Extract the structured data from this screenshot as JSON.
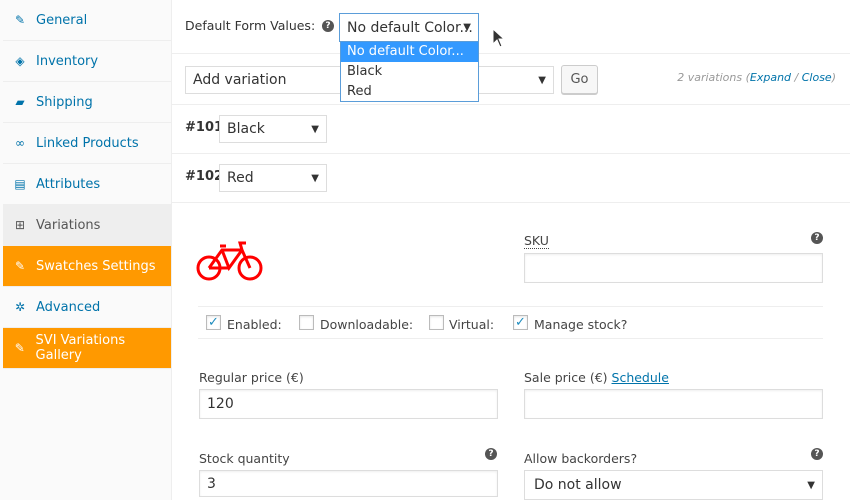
{
  "sidebar": {
    "items": [
      {
        "label": "General",
        "icon": "wrench-icon",
        "state": "normal"
      },
      {
        "label": "Inventory",
        "icon": "tag-icon",
        "state": "normal"
      },
      {
        "label": "Shipping",
        "icon": "truck-icon",
        "state": "normal"
      },
      {
        "label": "Linked Products",
        "icon": "link-icon",
        "state": "normal"
      },
      {
        "label": "Attributes",
        "icon": "list-icon",
        "state": "normal"
      },
      {
        "label": "Variations",
        "icon": "grid-icon",
        "state": "active"
      },
      {
        "label": "Swatches Settings",
        "icon": "wrench-icon",
        "state": "orange"
      },
      {
        "label": "Advanced",
        "icon": "gear-icon",
        "state": "normal"
      },
      {
        "label": "SVI Variations Gallery",
        "icon": "wrench-icon",
        "state": "orange"
      }
    ]
  },
  "defaults": {
    "label": "Default Form Values:",
    "selected": "No default Color...",
    "options": [
      "No default Color...",
      "Black",
      "Red"
    ]
  },
  "add": {
    "selected": "Add variation",
    "go": "Go",
    "count": "2 variations (",
    "expand": "Expand",
    "sep": " / ",
    "close": "Close",
    "end": ")"
  },
  "variations": [
    {
      "id": "#101",
      "value": "Black"
    },
    {
      "id": "#102",
      "value": "Red"
    }
  ],
  "panel": {
    "sku_label": "SKU",
    "sku_value": "",
    "checks": [
      {
        "label": "Enabled:",
        "checked": true
      },
      {
        "label": "Downloadable:",
        "checked": false
      },
      {
        "label": "Virtual:",
        "checked": false
      },
      {
        "label": "Manage stock?",
        "checked": true
      }
    ],
    "regular_label": "Regular price (€)",
    "regular_value": "120",
    "sale_label": "Sale price (€)",
    "schedule": "Schedule",
    "sale_value": "",
    "stock_label": "Stock quantity",
    "stock_value": "3",
    "backorders_label": "Allow backorders?",
    "backorders_value": "Do not allow"
  },
  "colors": {
    "accent": "#0073aa",
    "orange": "#ff9900",
    "highlight": "#3399ff",
    "bike": "#ff0000"
  }
}
